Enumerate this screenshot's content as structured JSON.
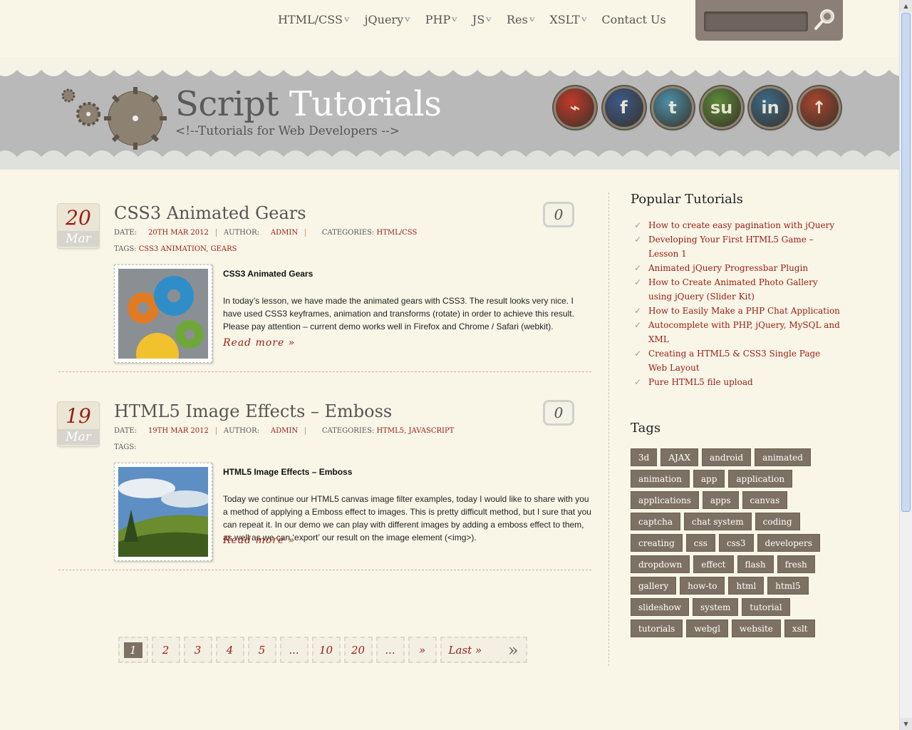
{
  "nav": {
    "items": [
      {
        "label": "HTML/CSS",
        "dropdown": true
      },
      {
        "label": "jQuery",
        "dropdown": true
      },
      {
        "label": "PHP",
        "dropdown": true
      },
      {
        "label": "JS",
        "dropdown": true
      },
      {
        "label": "Res",
        "dropdown": true
      },
      {
        "label": "XSLT",
        "dropdown": true
      },
      {
        "label": "Contact Us",
        "dropdown": false
      }
    ],
    "search_value": ""
  },
  "header": {
    "title_part1": "Script",
    "title_part2": "Tutorials",
    "subtitle": "<!--Tutorials for Web Developers -->",
    "social": [
      {
        "name": "rss-icon",
        "glyph": "⌁",
        "color": "#c0392b"
      },
      {
        "name": "facebook-icon",
        "glyph": "f",
        "color": "#3b5a8a"
      },
      {
        "name": "twitter-icon",
        "glyph": "t",
        "color": "#4a8fa8"
      },
      {
        "name": "stumbleupon-icon",
        "glyph": "su",
        "color": "#5b8a3a"
      },
      {
        "name": "linkedin-icon",
        "glyph": "in",
        "color": "#3b6a8a"
      },
      {
        "name": "digg-icon",
        "glyph": "↑",
        "color": "#a8452f"
      }
    ]
  },
  "posts": [
    {
      "day": "20",
      "month": "Mar",
      "title": "CSS3 Animated Gears",
      "comments": "0",
      "date_label": "DATE:",
      "date": "20th Mar 2012",
      "author_label": "AUTHOR:",
      "author": "admin",
      "categories_label": "CATEGORIES:",
      "categories": "HTML/CSS",
      "tags_label": "TAGS:",
      "tags": "css3 animation, gears",
      "excerpt_title": "CSS3 Animated Gears",
      "excerpt": "In today’s lesson, we have made the animated gears with CSS3. The result looks very nice. I have used CSS3 keyframes, animation and transforms (rotate) in order to achieve this result. Please pay attention – current demo works well in Firefox and Chrome / Safari (webkit).",
      "read_more": "Read more »"
    },
    {
      "day": "19",
      "month": "Mar",
      "title": "HTML5 Image Effects – Emboss",
      "comments": "0",
      "date_label": "DATE:",
      "date": "19th Mar 2012",
      "author_label": "AUTHOR:",
      "author": "admin",
      "categories_label": "CATEGORIES:",
      "categories": "HTML5, JavaScript",
      "tags_label": "TAGS:",
      "tags": "",
      "excerpt_title": "HTML5 Image Effects – Emboss",
      "excerpt": "Today we continue our HTML5 canvas image filter examples, today I would like to share with you a method of applying a Emboss effect to images. This is pretty difficult method, but I sure that you can repeat it. In our demo we can play with different images by adding a emboss effect to them, as well as we can ‘export’ our result on the image element (<img>).",
      "read_more": "Read more »"
    }
  ],
  "pagination": {
    "pages": [
      "1",
      "2",
      "3",
      "4",
      "5",
      "...",
      "10",
      "20",
      "...",
      "»"
    ],
    "active": "1",
    "last_label": "Last »",
    "last_glyph": "»"
  },
  "sidebar": {
    "popular_title": "Popular Tutorials",
    "popular": [
      "How to create easy pagination with jQuery",
      "Developing Your First HTML5 Game – Lesson 1",
      "Animated jQuery Progressbar Plugin",
      "How to Create Animated Photo Gallery using jQuery (Slider Kit)",
      "How to Easily Make a PHP Chat Application",
      "Autocomplete with PHP, jQuery, MySQL and XML",
      "Creating a HTML5 & CSS3 Single Page Web Layout",
      "Pure HTML5 file upload"
    ],
    "tags_title": "Tags",
    "tags": [
      "3d",
      "AJAX",
      "android",
      "animated",
      "animation",
      "app",
      "application",
      "applications",
      "apps",
      "canvas",
      "captcha",
      "chat system",
      "coding",
      "creating",
      "css",
      "css3",
      "developers",
      "dropdown",
      "effect",
      "flash",
      "fresh",
      "gallery",
      "how-to",
      "html",
      "html5",
      "slideshow",
      "system",
      "tutorial",
      "tutorials",
      "webgl",
      "website",
      "xslt"
    ]
  }
}
